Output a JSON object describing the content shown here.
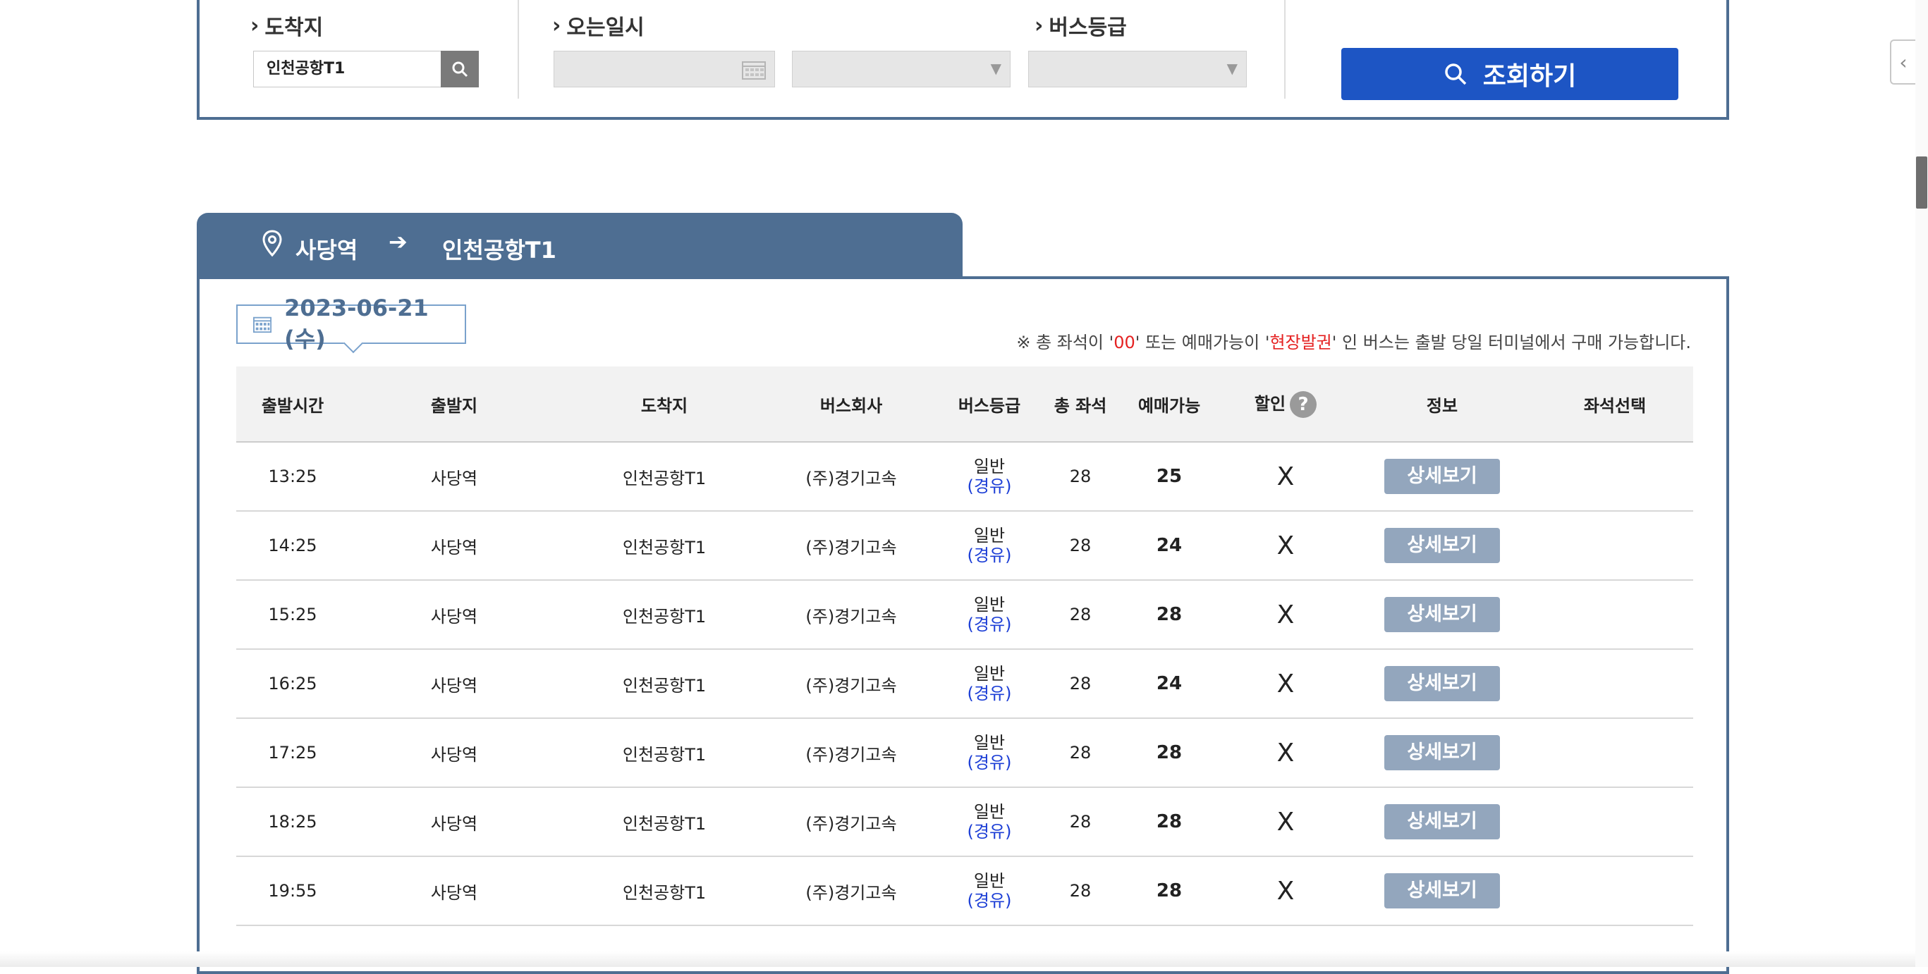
{
  "search": {
    "destination_label": "도착지",
    "destination_value": "인천공항T1",
    "return_date_label": "오는일시",
    "bus_grade_label": "버스등급",
    "query_button_label": "조회하기"
  },
  "route": {
    "from": "사당역",
    "to": "인천공항T1"
  },
  "date": "2023-06-21 (수)",
  "notice": {
    "prefix": "※ 총 좌석이 '",
    "zero": "00",
    "middle": "' 또는 예매가능이 '",
    "onsite": "현장발권",
    "suffix": "' 인 버스는 출발 당일 터미널에서 구매 가능합니다."
  },
  "table": {
    "headers": [
      "출발시간",
      "출발지",
      "도착지",
      "버스회사",
      "버스등급",
      "총 좌석",
      "예매가능",
      "할인",
      "정보",
      "좌석선택"
    ],
    "rows": [
      {
        "time": "13:25",
        "from": "사당역",
        "to": "인천공항T1",
        "company": "(주)경기고속",
        "grade": "일반",
        "via": "(경유)",
        "total": "28",
        "avail": "25",
        "discount": "X",
        "info": "상세보기"
      },
      {
        "time": "14:25",
        "from": "사당역",
        "to": "인천공항T1",
        "company": "(주)경기고속",
        "grade": "일반",
        "via": "(경유)",
        "total": "28",
        "avail": "24",
        "discount": "X",
        "info": "상세보기"
      },
      {
        "time": "15:25",
        "from": "사당역",
        "to": "인천공항T1",
        "company": "(주)경기고속",
        "grade": "일반",
        "via": "(경유)",
        "total": "28",
        "avail": "28",
        "discount": "X",
        "info": "상세보기"
      },
      {
        "time": "16:25",
        "from": "사당역",
        "to": "인천공항T1",
        "company": "(주)경기고속",
        "grade": "일반",
        "via": "(경유)",
        "total": "28",
        "avail": "24",
        "discount": "X",
        "info": "상세보기"
      },
      {
        "time": "17:25",
        "from": "사당역",
        "to": "인천공항T1",
        "company": "(주)경기고속",
        "grade": "일반",
        "via": "(경유)",
        "total": "28",
        "avail": "28",
        "discount": "X",
        "info": "상세보기"
      },
      {
        "time": "18:25",
        "from": "사당역",
        "to": "인천공항T1",
        "company": "(주)경기고속",
        "grade": "일반",
        "via": "(경유)",
        "total": "28",
        "avail": "28",
        "discount": "X",
        "info": "상세보기"
      },
      {
        "time": "19:55",
        "from": "사당역",
        "to": "인천공항T1",
        "company": "(주)경기고속",
        "grade": "일반",
        "via": "(경유)",
        "total": "28",
        "avail": "28",
        "discount": "X",
        "info": "상세보기"
      }
    ]
  },
  "icons": {
    "help": "help-icon",
    "calendar": "calendar-icon",
    "search": "search-icon",
    "pin": "map-pin-icon",
    "arrow": "arrow-right-icon"
  },
  "colors": {
    "panel_border": "#4e6e92",
    "primary_button": "#1d55c4",
    "detail_button": "#93a6bd",
    "highlight_red": "#e52222",
    "via_blue": "#1d3fd6"
  }
}
